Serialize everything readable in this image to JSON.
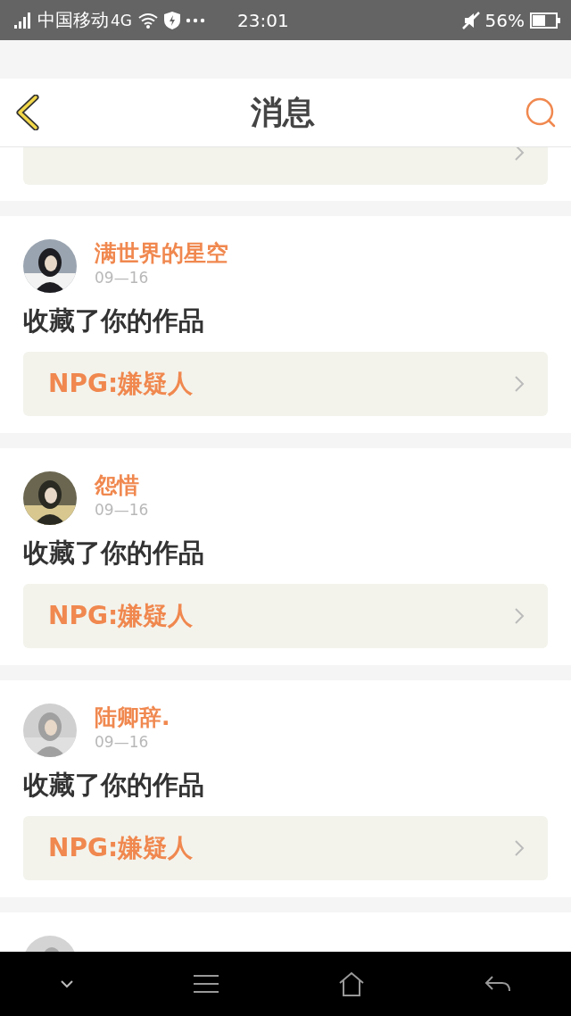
{
  "status_bar": {
    "carrier": "中国移动",
    "network": "4G",
    "time": "23:01",
    "battery": "56%"
  },
  "header": {
    "title": "消息"
  },
  "messages": [
    {
      "kind": "partial"
    },
    {
      "kind": "full",
      "user": "满世界的星空",
      "date": "09—16",
      "action": "收藏了你的作品",
      "work": "NPG:嫌疑人"
    },
    {
      "kind": "full",
      "user": "怨惜",
      "date": "09—16",
      "action": "收藏了你的作品",
      "work": "NPG:嫌疑人"
    },
    {
      "kind": "full",
      "user": "陆卿辞.",
      "date": "09—16",
      "action": "收藏了你的作品",
      "work": "NPG:嫌疑人"
    },
    {
      "kind": "avatar_only"
    }
  ]
}
